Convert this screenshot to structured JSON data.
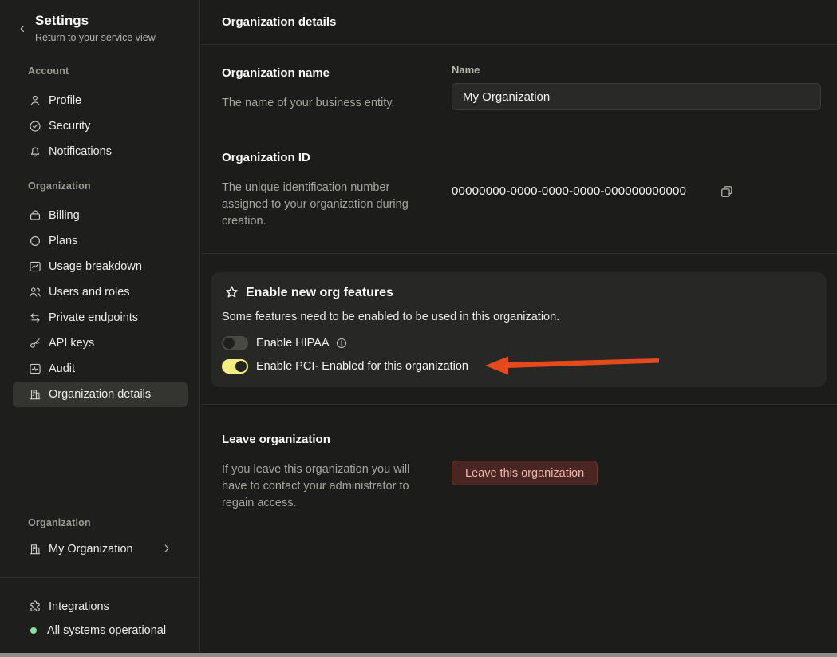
{
  "colors": {
    "accent_toggle_on": "#f2ee7f",
    "arrow_annotation": "#e64a1c",
    "status_ok": "#8ce0a4",
    "danger_button_bg": "#4a2521",
    "danger_button_text": "#efb6ad",
    "selected_item_bg": "#343431"
  },
  "sidebar": {
    "title": "Settings",
    "subtitle": "Return to your service view",
    "sections": [
      {
        "label": "Account",
        "items": [
          {
            "label": "Profile",
            "icon": "user",
            "selected": false
          },
          {
            "label": "Security",
            "icon": "security",
            "selected": false
          },
          {
            "label": "Notifications",
            "icon": "bell",
            "selected": false
          }
        ]
      },
      {
        "label": "Organization",
        "items": [
          {
            "label": "Billing",
            "icon": "billing",
            "selected": false
          },
          {
            "label": "Plans",
            "icon": "plans",
            "selected": false
          },
          {
            "label": "Usage breakdown",
            "icon": "usage-chart",
            "selected": false
          },
          {
            "label": "Users and roles",
            "icon": "users",
            "selected": false
          },
          {
            "label": "Private endpoints",
            "icon": "arrows-swap",
            "selected": false
          },
          {
            "label": "API keys",
            "icon": "key",
            "selected": false
          },
          {
            "label": "Audit",
            "icon": "audit-pulse",
            "selected": false
          },
          {
            "label": "Organization details",
            "icon": "building",
            "selected": true
          }
        ]
      }
    ],
    "org_switcher": {
      "label": "Organization",
      "name": "My Organization"
    },
    "footer": {
      "integrations": "Integrations",
      "status": "All systems operational"
    }
  },
  "header": {
    "title": "Organization details"
  },
  "main": {
    "org_name": {
      "title": "Organization name",
      "description": "The name of your business entity.",
      "field_label": "Name",
      "field_value": "My Organization"
    },
    "org_id": {
      "title": "Organization ID",
      "description": "The unique identification number assigned to your organization during creation.",
      "value": "00000000-0000-0000-0000-000000000000"
    },
    "features": {
      "title": "Enable new org features",
      "description": "Some features need to be enabled to be used in this organization.",
      "toggles": [
        {
          "label": "Enable HIPAA",
          "enabled": false,
          "has_info": true
        },
        {
          "label": "Enable PCI- Enabled for this organization",
          "enabled": true,
          "has_info": false
        }
      ]
    },
    "leave": {
      "title": "Leave organization",
      "description": "If you leave this organization you will have to contact your administrator to regain access.",
      "button_label": "Leave this organization"
    }
  }
}
